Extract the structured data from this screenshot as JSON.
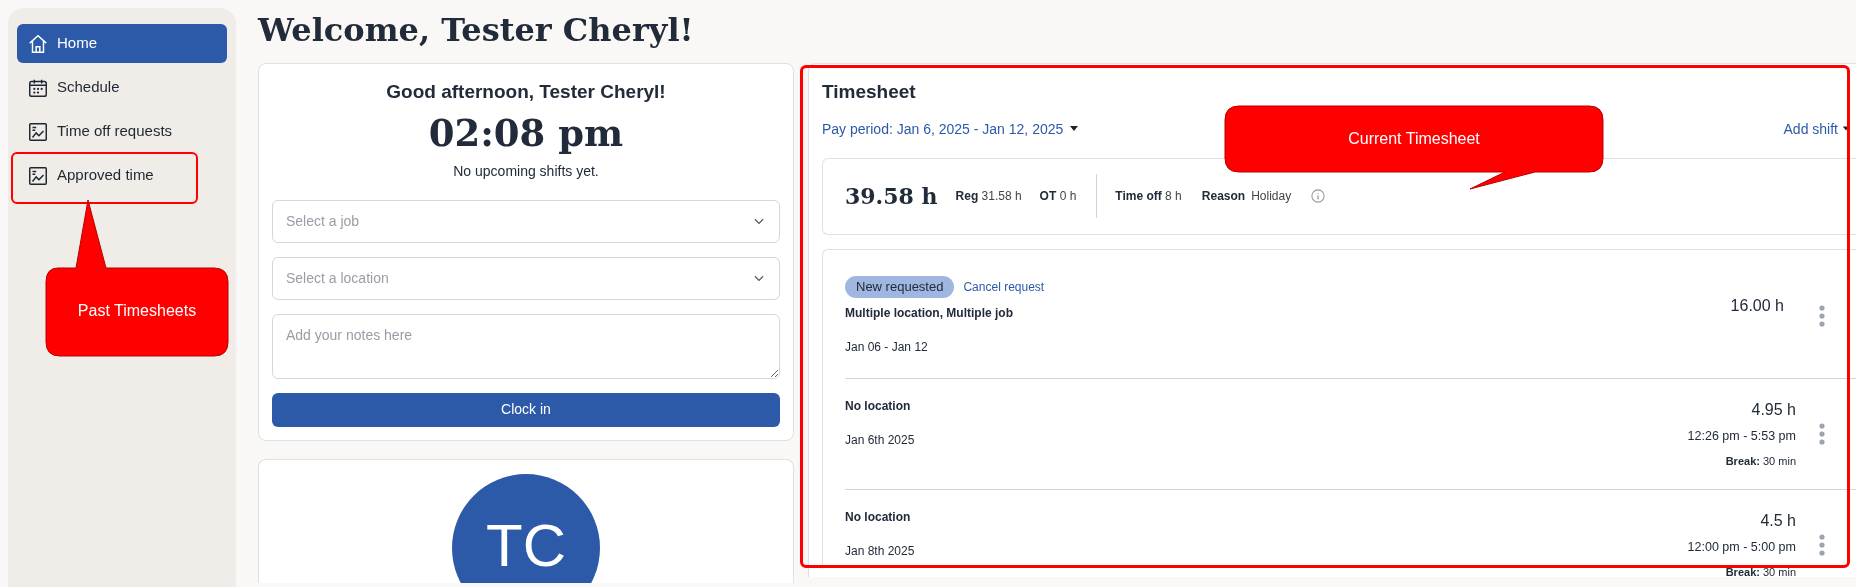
{
  "sidebar": {
    "items": [
      {
        "label": "Home",
        "selected": true
      },
      {
        "label": "Schedule",
        "selected": false
      },
      {
        "label": "Time off requests",
        "selected": false
      },
      {
        "label": "Approved time",
        "selected": false
      }
    ]
  },
  "page_title": "Welcome, Tester Cheryl!",
  "clock_card": {
    "greeting": "Good afternoon, Tester Cheryl!",
    "time": "02:08 pm",
    "note": "No upcoming shifts yet.",
    "job_select": {
      "placeholder": "Select a job"
    },
    "location_select": {
      "placeholder": "Select a location"
    },
    "notes": {
      "placeholder": "Add your notes here"
    },
    "button": "Clock in"
  },
  "profile_card": {
    "initials": "TC"
  },
  "timesheet": {
    "title": "Timesheet",
    "pay_period": "Pay period: Jan 6, 2025 - Jan 12, 2025",
    "add_shift": "Add shift",
    "summary": {
      "total": "39.58 h",
      "reg_label": "Reg",
      "reg_value": "31.58 h",
      "ot_label": "OT",
      "ot_value": "0 h",
      "timeoff_label": "Time off",
      "timeoff_value": "8 h",
      "reason_label": "Reason",
      "reason_value": "Holiday"
    },
    "entries": [
      {
        "kind": "request",
        "badge": "New requested",
        "link": "Cancel request",
        "title": "Multiple location, Multiple job",
        "date": "Jan 06 - Jan 12",
        "hours": "16.00 h"
      },
      {
        "kind": "shift",
        "title": "No location",
        "date": "Jan 6th 2025",
        "hours": "4.95 h",
        "range": "12:26 pm - 5:53 pm",
        "break_label": "Break:",
        "break_value": "30 min"
      },
      {
        "kind": "shift",
        "title": "No location",
        "date": "Jan 8th 2025",
        "hours": "4.5 h",
        "range": "12:00 pm - 5:00 pm",
        "break_label": "Break:",
        "break_value": "30 min"
      }
    ]
  },
  "annotations": [
    {
      "kind": "callout",
      "text": "Past Timesheets"
    },
    {
      "kind": "callout",
      "text": "Current Timesheet"
    }
  ]
}
